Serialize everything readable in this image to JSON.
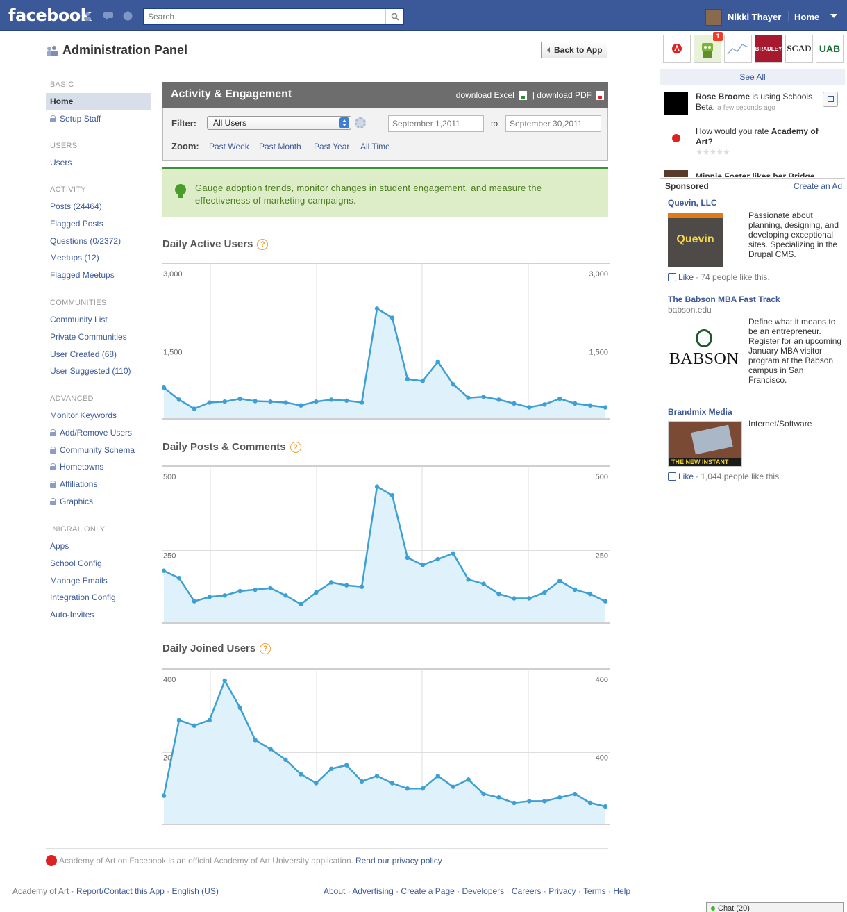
{
  "topbar": {
    "logo": "facebook",
    "search_placeholder": "Search",
    "user_name": "Nikki Thayer",
    "home": "Home"
  },
  "admin": {
    "title": "Administration Panel",
    "back_button": "Back to App"
  },
  "nav": {
    "sections": [
      {
        "title": "BASIC",
        "items": [
          {
            "label": "Home",
            "active": true,
            "locked": false
          },
          {
            "label": "Setup Staff",
            "locked": true
          }
        ]
      },
      {
        "title": "USERS",
        "items": [
          {
            "label": "Users",
            "locked": false
          }
        ]
      },
      {
        "title": "ACTIVITY",
        "items": [
          {
            "label": "Posts (24464)"
          },
          {
            "label": "Flagged Posts"
          },
          {
            "label": "Questions (0/2372)"
          },
          {
            "label": "Meetups (12)"
          },
          {
            "label": "Flagged Meetups"
          }
        ]
      },
      {
        "title": "COMMUNITIES",
        "items": [
          {
            "label": "Community List"
          },
          {
            "label": "Private Communities"
          },
          {
            "label": "User Created (68)"
          },
          {
            "label": "User Suggested (110)"
          }
        ]
      },
      {
        "title": "ADVANCED",
        "items": [
          {
            "label": "Monitor Keywords"
          },
          {
            "label": "Add/Remove Users",
            "locked": true
          },
          {
            "label": "Community Schema",
            "locked": true
          },
          {
            "label": "Hometowns",
            "locked": true
          },
          {
            "label": "Affiliations",
            "locked": true
          },
          {
            "label": "Graphics",
            "locked": true
          }
        ]
      },
      {
        "title": "INIGRAL ONLY",
        "items": [
          {
            "label": "Apps"
          },
          {
            "label": "School Config"
          },
          {
            "label": "Manage Emails"
          },
          {
            "label": "Integration Config"
          },
          {
            "label": "Auto-Invites"
          }
        ]
      }
    ]
  },
  "activity": {
    "title": "Activity & Engagement",
    "download_excel": "download Excel",
    "download_pdf": "| download PDF",
    "filter_label": "Filter:",
    "filter_value": "All Users",
    "date_from": "September 1,2011",
    "to_label": "to",
    "date_to": "September 30,2011",
    "zoom_label": "Zoom:",
    "zoom_options": [
      "Past Week",
      "Past Month",
      "Past Year",
      "All Time"
    ],
    "info_text": "Gauge adoption trends, monitor changes in student engagement, and measure the effectiveness of marketing campaigns."
  },
  "chart_data": [
    {
      "type": "area",
      "title": "Daily Active Users",
      "ylim": [
        0,
        3000
      ],
      "y_ticks_left": [
        "3,000",
        "1,500"
      ],
      "y_ticks_right": [
        "3,000",
        "1,500"
      ],
      "grid": true,
      "values": [
        650,
        400,
        210,
        340,
        360,
        420,
        370,
        360,
        340,
        280,
        360,
        400,
        380,
        340,
        2300,
        2110,
        830,
        790,
        1190,
        720,
        440,
        460,
        400,
        320,
        240,
        300,
        420,
        320,
        280,
        240
      ]
    },
    {
      "type": "area",
      "title": "Daily Posts & Comments",
      "ylim": [
        0,
        500
      ],
      "y_ticks_left": [
        "500",
        "250"
      ],
      "y_ticks_right": [
        "500",
        "250"
      ],
      "grid": true,
      "values": [
        180,
        155,
        75,
        90,
        95,
        110,
        115,
        120,
        95,
        65,
        105,
        140,
        130,
        125,
        470,
        440,
        225,
        200,
        220,
        240,
        150,
        135,
        100,
        85,
        85,
        105,
        145,
        115,
        100,
        75
      ]
    },
    {
      "type": "area",
      "title": "Daily Joined Users",
      "ylim": [
        0,
        400
      ],
      "y_ticks_left": [
        "400",
        "20"
      ],
      "y_ticks_right": [
        "400",
        "400"
      ],
      "grid": true,
      "values": [
        80,
        290,
        275,
        290,
        400,
        325,
        235,
        210,
        180,
        140,
        115,
        155,
        165,
        120,
        135,
        115,
        100,
        100,
        135,
        105,
        125,
        85,
        75,
        60,
        65,
        65,
        75,
        85,
        60,
        50
      ]
    }
  ],
  "footer": {
    "app_notice": "Academy of Art on Facebook is an official Academy of Art University application.",
    "privacy_link": "Read our privacy policy",
    "left_site": "Academy of Art",
    "left_links": "Report/Contact this App",
    "left_lang": "English (US)",
    "right_links": [
      "About",
      "Advertising",
      "Create a Page",
      "Developers",
      "Careers",
      "Privacy",
      "Terms",
      "Help"
    ]
  },
  "rightcol": {
    "bookmarks": [
      "SCAD",
      "UAB",
      "BRADLEY"
    ],
    "badge_count": "1",
    "see_all": "See All",
    "ticker1_name": "Rose Broome",
    "ticker1_text": "is using Schools Beta.",
    "ticker1_time": "a few seconds ago",
    "ticker2_text": "How would you rate",
    "ticker2_name": "Academy of Art?",
    "ticker3_text": "Minnie Foster likes her Bridge",
    "sponsored": "Sponsored",
    "create_ad": "Create an Ad",
    "ads": [
      {
        "title": "Quevin, LLC",
        "body": "Passionate about planning, designing, and developing exceptional sites. Specializing in the Drupal CMS.",
        "like": "Like",
        "like_text": "· 74 people like this.",
        "image_text": "Quevin"
      },
      {
        "title": "The Babson MBA Fast Track",
        "domain": "babson.edu",
        "body": "Define what it means to be an entrepreneur. Register for an upcoming January MBA visitor program at the Babson campus in San Francisco.",
        "image_text": "BABSON"
      },
      {
        "title": "Brandmix Media",
        "body": "Internet/Software",
        "like": "Like",
        "like_text": "· 1,044 people like this.",
        "image_text": "THE NEW INSTANT QUOTE!"
      }
    ],
    "chat": "Chat (20)"
  },
  "colors": {
    "fb_blue": "#3b5998",
    "chart_line": "#3d9fd3",
    "chart_fill": "#dff1fa",
    "info_green": "#dcedc8"
  }
}
